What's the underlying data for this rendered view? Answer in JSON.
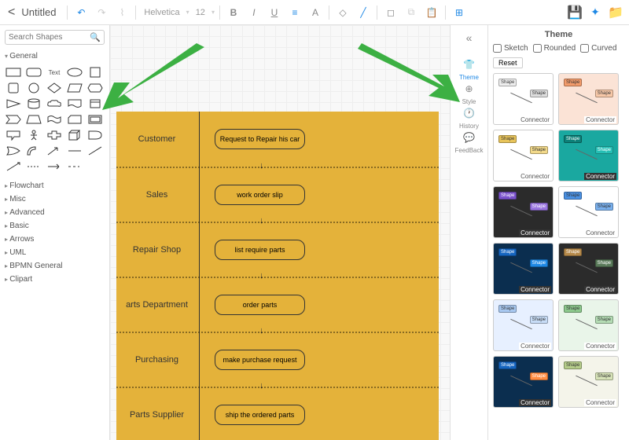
{
  "header": {
    "title": "Untitled",
    "font": "Helvetica",
    "font_size": "12"
  },
  "search": {
    "placeholder": "Search Shapes"
  },
  "categories": [
    "General",
    "Flowchart",
    "Misc",
    "Advanced",
    "Basic",
    "Arrows",
    "UML",
    "BPMN General",
    "Clipart"
  ],
  "lanes": [
    {
      "label": "Customer",
      "box": "Request to Repair his car"
    },
    {
      "label": "Sales",
      "box": "work order slip"
    },
    {
      "label": "Repair Shop",
      "box": "list require parts"
    },
    {
      "label": "arts Department",
      "box": "order parts"
    },
    {
      "label": "Purchasing",
      "box": "make purchase request"
    },
    {
      "label": "Parts Supplier",
      "box": "ship the ordered parts"
    }
  ],
  "sidebar": [
    {
      "label": "Theme",
      "icon": "👕"
    },
    {
      "label": "Style",
      "icon": "⊕"
    },
    {
      "label": "History",
      "icon": "🕐"
    },
    {
      "label": "FeedBack",
      "icon": "💬"
    }
  ],
  "theme": {
    "title": "Theme",
    "sketch": "Sketch",
    "rounded": "Rounded",
    "curved": "Curved",
    "reset": "Reset",
    "connector": "Connector",
    "shape": "Shape",
    "themes": [
      {
        "bg": "#ffffff",
        "c1": "#eee",
        "c2": "#ddd",
        "dark": false
      },
      {
        "bg": "#fbe3d6",
        "c1": "#f29b6b",
        "c2": "#f7c8a8",
        "dark": false
      },
      {
        "bg": "#ffffff",
        "c1": "#e8c45a",
        "c2": "#f2d98a",
        "dark": false
      },
      {
        "bg": "#1aa8a0",
        "c1": "#0d8078",
        "c2": "#26bfb5",
        "dark": true
      },
      {
        "bg": "#2b2b2b",
        "c1": "#7a52cc",
        "c2": "#9975e0",
        "dark": true
      },
      {
        "bg": "#ffffff",
        "c1": "#4a90e2",
        "c2": "#7ab0ed",
        "dark": false
      },
      {
        "bg": "#0b2e4f",
        "c1": "#1565c0",
        "c2": "#1e88e5",
        "dark": true
      },
      {
        "bg": "#2b2b2b",
        "c1": "#b5894a",
        "c2": "#5a7a5a",
        "dark": true
      },
      {
        "bg": "#e7f0ff",
        "c1": "#a8c8f0",
        "c2": "#c7dcf6",
        "dark": false
      },
      {
        "bg": "#e9f5e9",
        "c1": "#8cc88c",
        "c2": "#b4dcb4",
        "dark": false
      },
      {
        "bg": "#0b2e4f",
        "c1": "#1565c0",
        "c2": "#ff8c42",
        "dark": true
      },
      {
        "bg": "#f4f4ea",
        "c1": "#b5cc8a",
        "c2": "#d7e3b8",
        "dark": false
      }
    ]
  }
}
